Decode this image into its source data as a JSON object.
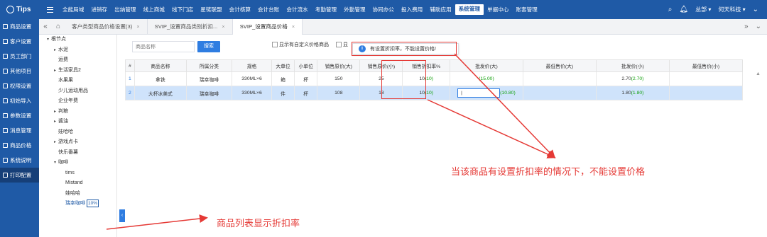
{
  "brand": {
    "name": "Tips"
  },
  "menu": [
    "全能局域",
    "进销存",
    "出纳管理",
    "线上商城",
    "线下门店",
    "星链联盟",
    "会计核算",
    "会计台账",
    "会计流水",
    "考勤管理",
    "外勤管理",
    "协同办公",
    "投入费用",
    "辅助应用",
    "系统管理",
    "单据中心",
    "账套管理"
  ],
  "menu_active": "系统管理",
  "top_right": {
    "search_icon": "search-icon",
    "bell_icon": "bell-icon",
    "user": "总部 ▾",
    "company": "何天科技 ▾"
  },
  "leftnav": [
    "商品设置",
    "客户设置",
    "员工部门",
    "其他项目",
    "权限设置",
    "初始导入",
    "参数设置",
    "消息管理",
    "商品价格",
    "系统说明",
    "打印配置"
  ],
  "tabs": [
    {
      "label": "客户类型商品价格设置(3)"
    },
    {
      "label": "SVIP_设置商品类别折扣..."
    },
    {
      "label": "SVIP_设置商品价格"
    }
  ],
  "tree": [
    {
      "label": "根节点",
      "level": 0,
      "arrow": "▾"
    },
    {
      "label": "水泥",
      "level": 1,
      "arrow": "▸"
    },
    {
      "label": "运费",
      "level": 1,
      "arrow": ""
    },
    {
      "label": "生活家具2",
      "level": 1,
      "arrow": "▸"
    },
    {
      "label": "水果果",
      "level": 1,
      "arrow": ""
    },
    {
      "label": "少儿运动用品",
      "level": 1,
      "arrow": ""
    },
    {
      "label": "企业年费",
      "level": 1,
      "arrow": ""
    },
    {
      "label": "判粮",
      "level": 1,
      "arrow": "▸"
    },
    {
      "label": "酱油",
      "level": 1,
      "arrow": "▸"
    },
    {
      "label": "娃哈哈",
      "level": 1,
      "arrow": ""
    },
    {
      "label": "游戏点卡",
      "level": 1,
      "arrow": "▸"
    },
    {
      "label": "快乐番薯",
      "level": 1,
      "arrow": ""
    },
    {
      "label": "咖啡",
      "level": 1,
      "arrow": "▾"
    },
    {
      "label": "tims",
      "level": 2,
      "arrow": ""
    },
    {
      "label": "Mistand",
      "level": 2,
      "arrow": ""
    },
    {
      "label": "娃哈哈",
      "level": 2,
      "arrow": ""
    },
    {
      "label": "瑞幸咖啡",
      "level": 2,
      "arrow": "",
      "badge": "10%"
    }
  ],
  "search": {
    "placeholder": "商品名称",
    "button": "搜索"
  },
  "checks": {
    "custom_price": "显示有自定义价格商品",
    "other": "显"
  },
  "tooltip": "有设置折扣率，不能设置价格!",
  "columns": [
    "#",
    "商品名称",
    "所属分类",
    "规格",
    "大单位",
    "小单位",
    "销售原价(大)",
    "销售原价(小)",
    "销售折扣率%",
    "批发价(大)",
    "最低售价(大)",
    "批发价(小)",
    "最低售价(小)"
  ],
  "rows": [
    {
      "num": "1",
      "name": "拿铁",
      "category": "瑞幸咖啡",
      "spec": "330ML×6",
      "unit_big": "箱",
      "unit_small": "杯",
      "price_big": "150",
      "price_small": "25",
      "discount": "10",
      "discount_hint": "(10)",
      "wholesale_big": "",
      "wholesale_big_hint": "(15.00)",
      "min_big": "",
      "wholesale_small": "2.70",
      "wholesale_small_hint": "(2.70)",
      "min_small": ""
    },
    {
      "num": "2",
      "name": "大杯冰美式",
      "category": "瑞幸咖啡",
      "spec": "330ML×6",
      "unit_big": "件",
      "unit_small": "杯",
      "price_big": "108",
      "price_small": "18",
      "discount": "10",
      "discount_hint": "(10)",
      "wholesale_big": "|",
      "wholesale_big_hint": "(10.80)",
      "min_big": "",
      "wholesale_small": "1.80",
      "wholesale_small_hint": "(1.80)",
      "min_small": ""
    }
  ],
  "annotations": {
    "cannot_set_price": "当该商品有设置折扣率的情况下，不能设置价格",
    "list_shows_discount": "商品列表显示折扣率"
  },
  "colors": {
    "primary": "#1f5aa6",
    "accent": "#2f7de1",
    "annotation": "#e53935",
    "hint": "#13a10e"
  }
}
